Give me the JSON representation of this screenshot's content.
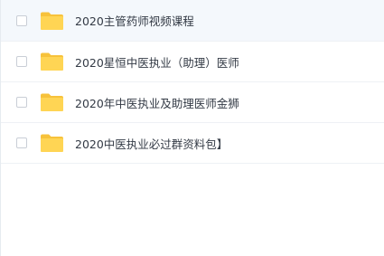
{
  "files": [
    {
      "name": "2020主管药师视频课程",
      "type": "folder",
      "selected": false
    },
    {
      "name": "2020星恒中医执业（助理）医师",
      "type": "folder",
      "selected": false
    },
    {
      "name": "2020年中医执业及助理医师金狮",
      "type": "folder",
      "selected": false
    },
    {
      "name": "2020中医执业必过群资料包】",
      "type": "folder",
      "selected": false
    }
  ],
  "colors": {
    "folder": "#ffd554",
    "folder_tab": "#f7c23b",
    "row_highlight": "#f4f8fc",
    "text": "#333a45"
  },
  "icons": {
    "folder": "folder-icon",
    "checkbox": "checkbox"
  }
}
